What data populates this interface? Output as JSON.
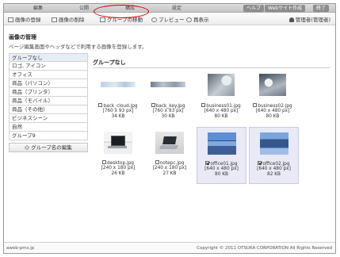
{
  "topbar": {
    "tabs": [
      "編集",
      "公開",
      "構成",
      "設定"
    ],
    "website_button": "Webサイト作成",
    "help_button": "ヘルプ",
    "exit_button": "終了"
  },
  "toolbar": {
    "register": "画像の登録",
    "delete": "画像の削除",
    "move_group": "グループの移動",
    "preview": "プレビュー",
    "redisplay": "再表示",
    "user": "管理者(管理者)"
  },
  "page": {
    "title": "画像の管理",
    "description": "ページ編集画面やヘッダなどで利用する画像を登録します。"
  },
  "sidebar": {
    "items": [
      {
        "label": "グループなし"
      },
      {
        "label": "ロゴ, アイコン"
      },
      {
        "label": "オフィス"
      },
      {
        "label": "商品（パソコン）"
      },
      {
        "label": "商品（プリンタ）"
      },
      {
        "label": "商品（モバイル）"
      },
      {
        "label": "商品（その他）"
      },
      {
        "label": "ビジネスシーン"
      },
      {
        "label": "自然"
      },
      {
        "label": "グループ9"
      }
    ],
    "edit_button": "グループ名の編集"
  },
  "main": {
    "group_title": "グループなし",
    "images": [
      {
        "name": "back_cloud.jpg",
        "dims": "[760 x 93 px]",
        "size": "34 KB",
        "checked": false,
        "selected": false
      },
      {
        "name": "back_key.jpg",
        "dims": "[760 x 93 px]",
        "size": "30 KB",
        "checked": false,
        "selected": false
      },
      {
        "name": "business01.jpg",
        "dims": "[640 x 480 px]",
        "size": "80 KB",
        "checked": false,
        "selected": false
      },
      {
        "name": "business02.jpg",
        "dims": "[640 x 480 px]",
        "size": "80 KB",
        "checked": false,
        "selected": false
      },
      {
        "name": "desktop.jpg",
        "dims": "[240 x 180 px]",
        "size": "26 KB",
        "checked": false,
        "selected": false
      },
      {
        "name": "notepc.jpg",
        "dims": "[240 x 180 px]",
        "size": "27 KB",
        "checked": false,
        "selected": false
      },
      {
        "name": "office01.jpg",
        "dims": "[640 x 480 px]",
        "size": "80 KB",
        "checked": true,
        "selected": true
      },
      {
        "name": "office02.jpg",
        "dims": "[640 x 480 px]",
        "size": "82 KB",
        "checked": true,
        "selected": true
      }
    ]
  },
  "footer": {
    "left": "aweb-pms.jp",
    "right": "Copyright © 2011 OTSUKA CORPORATION All Rights Reserved"
  },
  "colors": {
    "highlight_oval": "#d40000",
    "selected_tile": "#eaeaf6",
    "selected_sidebar": "#e8eef5"
  }
}
